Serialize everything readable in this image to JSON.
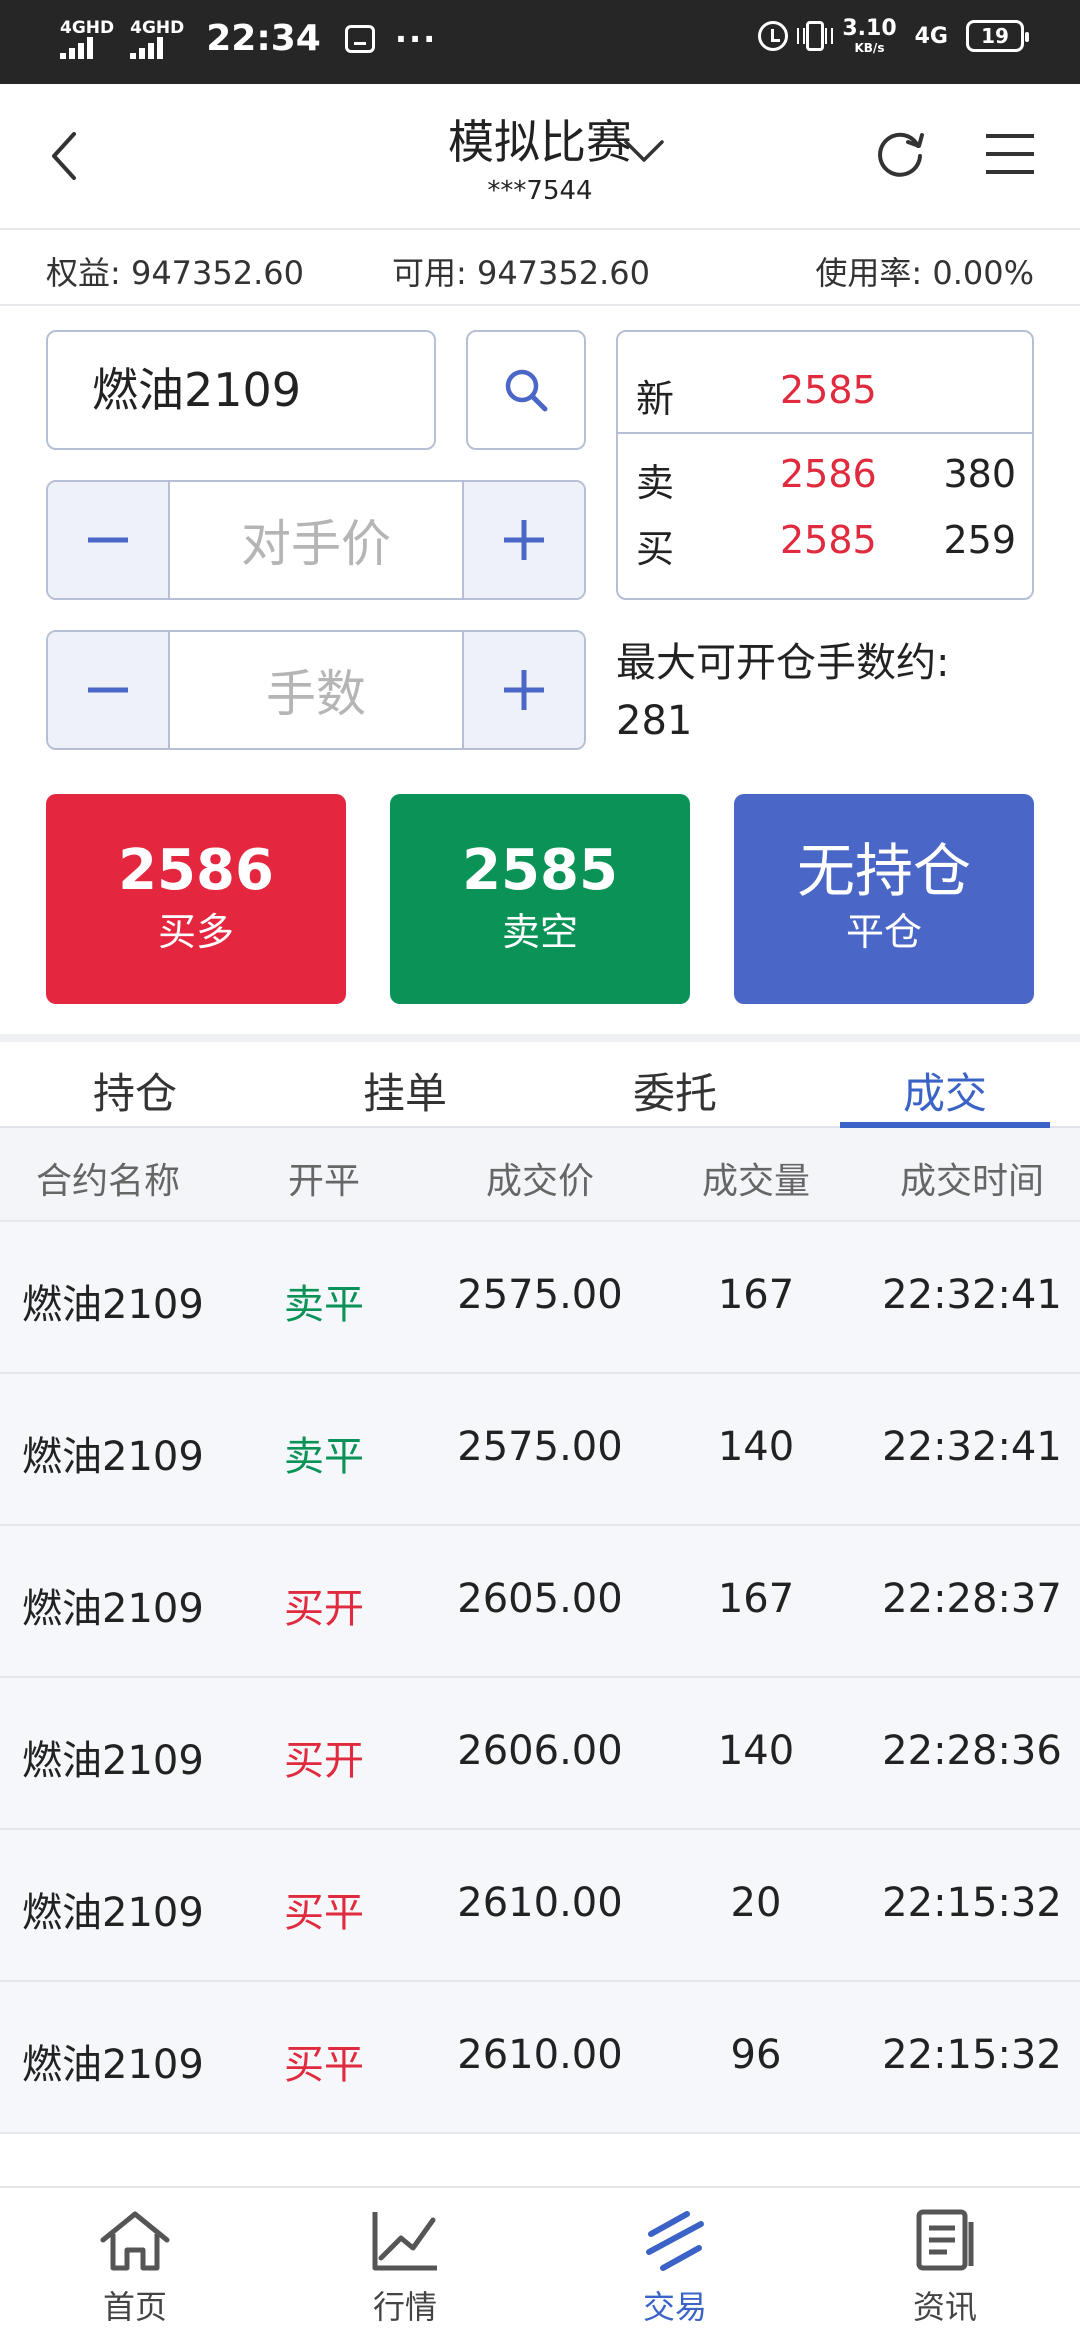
{
  "status_bar": {
    "signal1_label": "4GHD",
    "signal2_label": "4GHD",
    "time": "22:34",
    "more": "···",
    "speed_value": "3.10",
    "speed_unit": "KB/s",
    "network": "4G",
    "battery": "19"
  },
  "header": {
    "title": "模拟比赛",
    "account_masked": "***7544"
  },
  "account": {
    "equity": "权益: 947352.60",
    "available": "可用: 947352.60",
    "usage_rate": "使用率: 0.00%"
  },
  "order": {
    "contract": "燃油2109",
    "price_placeholder": "对手价",
    "qty_placeholder": "手数",
    "max_open_label": "最大可开仓手数约:",
    "max_open_value": "281"
  },
  "quote": {
    "last_label": "新",
    "last_price": "2585",
    "ask_label": "卖",
    "ask_price": "2586",
    "ask_volume": "380",
    "bid_label": "买",
    "bid_price": "2585",
    "bid_volume": "259"
  },
  "actions": {
    "buy_price": "2586",
    "buy_label": "买多",
    "sell_price": "2585",
    "sell_label": "卖空",
    "close_status": "无持仓",
    "close_label": "平仓"
  },
  "tabs": [
    {
      "label": "持仓"
    },
    {
      "label": "挂单"
    },
    {
      "label": "委托"
    },
    {
      "label": "成交"
    }
  ],
  "table": {
    "headers": [
      "合约名称",
      "开平",
      "成交价",
      "成交量",
      "成交时间"
    ],
    "rows": [
      {
        "contract": "燃油2109",
        "offset": "卖平",
        "price": "2575.00",
        "volume": "167",
        "time": "22:32:41"
      },
      {
        "contract": "燃油2109",
        "offset": "卖平",
        "price": "2575.00",
        "volume": "140",
        "time": "22:32:41"
      },
      {
        "contract": "燃油2109",
        "offset": "买开",
        "price": "2605.00",
        "volume": "167",
        "time": "22:28:37"
      },
      {
        "contract": "燃油2109",
        "offset": "买开",
        "price": "2606.00",
        "volume": "140",
        "time": "22:28:36"
      },
      {
        "contract": "燃油2109",
        "offset": "买平",
        "price": "2610.00",
        "volume": "20",
        "time": "22:15:32"
      },
      {
        "contract": "燃油2109",
        "offset": "买平",
        "price": "2610.00",
        "volume": "96",
        "time": "22:15:32"
      }
    ]
  },
  "nav": [
    {
      "label": "首页",
      "icon": "home-icon"
    },
    {
      "label": "行情",
      "icon": "chart-icon"
    },
    {
      "label": "交易",
      "icon": "trade-icon"
    },
    {
      "label": "资讯",
      "icon": "news-icon"
    }
  ],
  "colors": {
    "buy_red": "#e5263f",
    "sell_green": "#0a9257",
    "close_blue": "#4a66c6",
    "accent_blue": "#3b63c7"
  }
}
